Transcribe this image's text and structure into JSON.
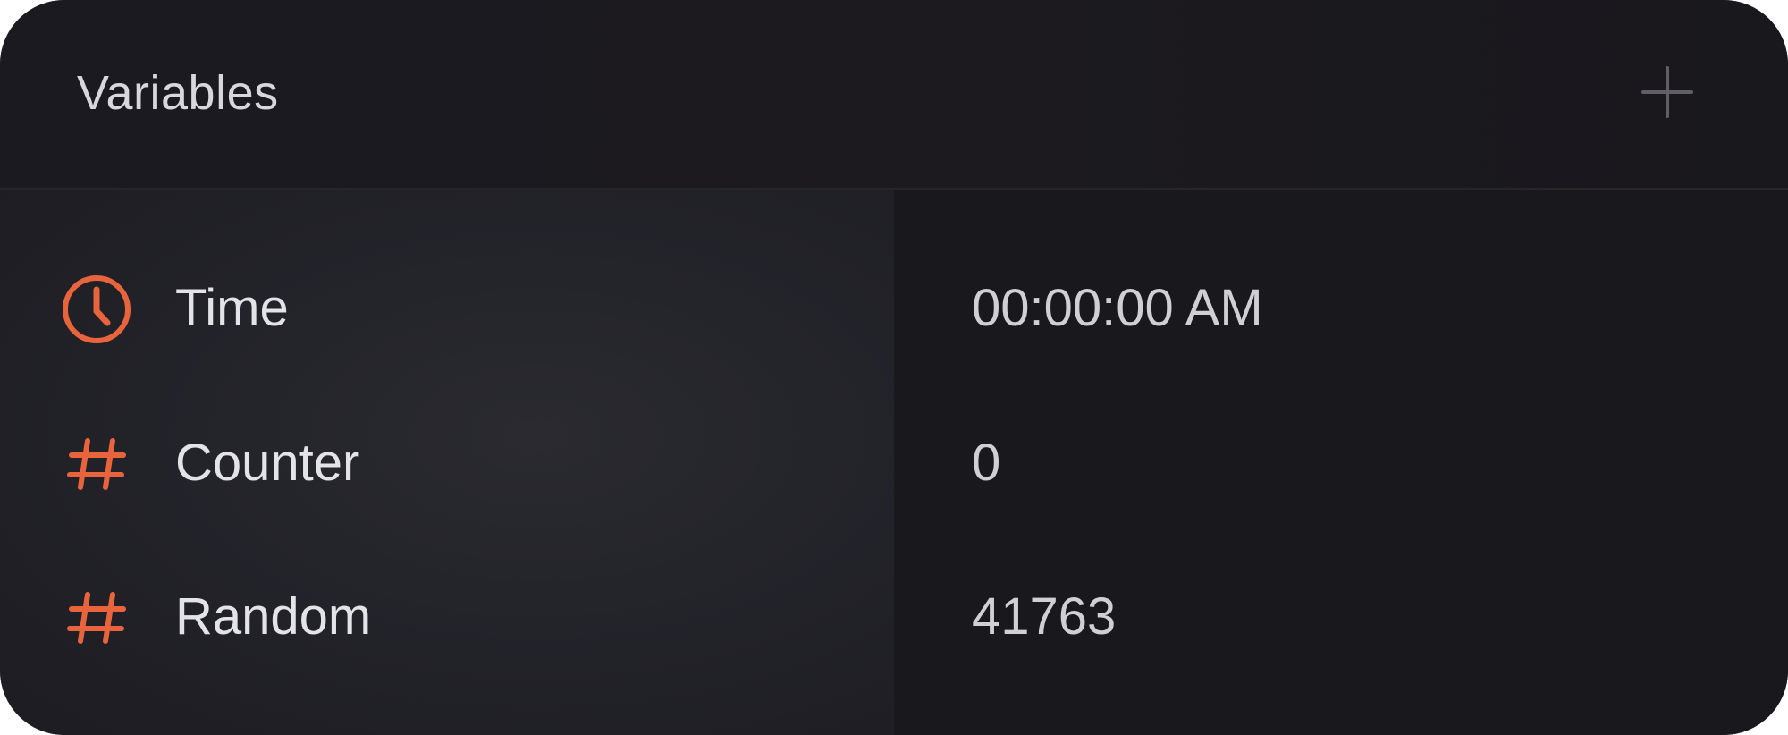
{
  "header": {
    "title": "Variables",
    "add_icon": "plus-icon"
  },
  "colors": {
    "accent": "#e8643c",
    "panel_bg": "#18171c",
    "text_primary": "#e4e4e8",
    "text_muted": "#5a5a60"
  },
  "variables": [
    {
      "icon": "clock-icon",
      "name": "Time",
      "value": "00:00:00 AM"
    },
    {
      "icon": "hash-icon",
      "name": "Counter",
      "value": "0"
    },
    {
      "icon": "hash-icon",
      "name": "Random",
      "value": "41763"
    }
  ]
}
